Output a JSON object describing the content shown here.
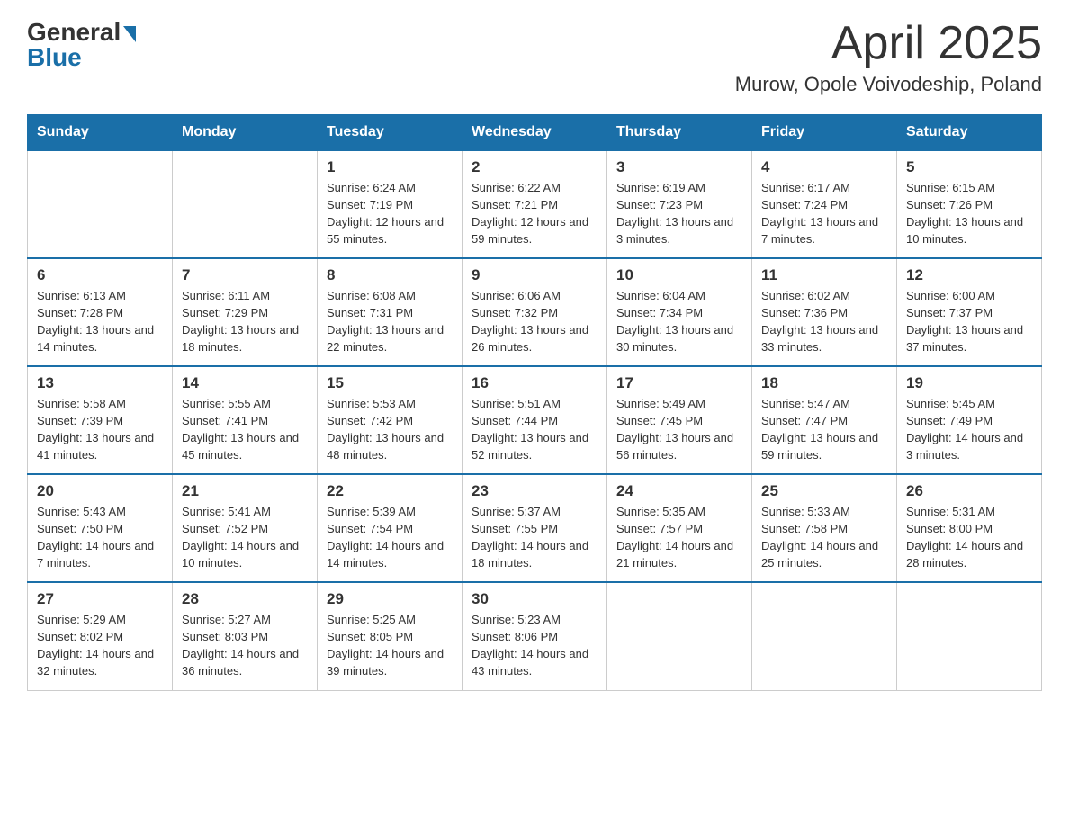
{
  "logo": {
    "general": "General",
    "blue": "Blue"
  },
  "header": {
    "month_year": "April 2025",
    "location": "Murow, Opole Voivodeship, Poland"
  },
  "weekdays": [
    "Sunday",
    "Monday",
    "Tuesday",
    "Wednesday",
    "Thursday",
    "Friday",
    "Saturday"
  ],
  "weeks": [
    [
      {
        "day": "",
        "sunrise": "",
        "sunset": "",
        "daylight": ""
      },
      {
        "day": "",
        "sunrise": "",
        "sunset": "",
        "daylight": ""
      },
      {
        "day": "1",
        "sunrise": "Sunrise: 6:24 AM",
        "sunset": "Sunset: 7:19 PM",
        "daylight": "Daylight: 12 hours and 55 minutes."
      },
      {
        "day": "2",
        "sunrise": "Sunrise: 6:22 AM",
        "sunset": "Sunset: 7:21 PM",
        "daylight": "Daylight: 12 hours and 59 minutes."
      },
      {
        "day": "3",
        "sunrise": "Sunrise: 6:19 AM",
        "sunset": "Sunset: 7:23 PM",
        "daylight": "Daylight: 13 hours and 3 minutes."
      },
      {
        "day": "4",
        "sunrise": "Sunrise: 6:17 AM",
        "sunset": "Sunset: 7:24 PM",
        "daylight": "Daylight: 13 hours and 7 minutes."
      },
      {
        "day": "5",
        "sunrise": "Sunrise: 6:15 AM",
        "sunset": "Sunset: 7:26 PM",
        "daylight": "Daylight: 13 hours and 10 minutes."
      }
    ],
    [
      {
        "day": "6",
        "sunrise": "Sunrise: 6:13 AM",
        "sunset": "Sunset: 7:28 PM",
        "daylight": "Daylight: 13 hours and 14 minutes."
      },
      {
        "day": "7",
        "sunrise": "Sunrise: 6:11 AM",
        "sunset": "Sunset: 7:29 PM",
        "daylight": "Daylight: 13 hours and 18 minutes."
      },
      {
        "day": "8",
        "sunrise": "Sunrise: 6:08 AM",
        "sunset": "Sunset: 7:31 PM",
        "daylight": "Daylight: 13 hours and 22 minutes."
      },
      {
        "day": "9",
        "sunrise": "Sunrise: 6:06 AM",
        "sunset": "Sunset: 7:32 PM",
        "daylight": "Daylight: 13 hours and 26 minutes."
      },
      {
        "day": "10",
        "sunrise": "Sunrise: 6:04 AM",
        "sunset": "Sunset: 7:34 PM",
        "daylight": "Daylight: 13 hours and 30 minutes."
      },
      {
        "day": "11",
        "sunrise": "Sunrise: 6:02 AM",
        "sunset": "Sunset: 7:36 PM",
        "daylight": "Daylight: 13 hours and 33 minutes."
      },
      {
        "day": "12",
        "sunrise": "Sunrise: 6:00 AM",
        "sunset": "Sunset: 7:37 PM",
        "daylight": "Daylight: 13 hours and 37 minutes."
      }
    ],
    [
      {
        "day": "13",
        "sunrise": "Sunrise: 5:58 AM",
        "sunset": "Sunset: 7:39 PM",
        "daylight": "Daylight: 13 hours and 41 minutes."
      },
      {
        "day": "14",
        "sunrise": "Sunrise: 5:55 AM",
        "sunset": "Sunset: 7:41 PM",
        "daylight": "Daylight: 13 hours and 45 minutes."
      },
      {
        "day": "15",
        "sunrise": "Sunrise: 5:53 AM",
        "sunset": "Sunset: 7:42 PM",
        "daylight": "Daylight: 13 hours and 48 minutes."
      },
      {
        "day": "16",
        "sunrise": "Sunrise: 5:51 AM",
        "sunset": "Sunset: 7:44 PM",
        "daylight": "Daylight: 13 hours and 52 minutes."
      },
      {
        "day": "17",
        "sunrise": "Sunrise: 5:49 AM",
        "sunset": "Sunset: 7:45 PM",
        "daylight": "Daylight: 13 hours and 56 minutes."
      },
      {
        "day": "18",
        "sunrise": "Sunrise: 5:47 AM",
        "sunset": "Sunset: 7:47 PM",
        "daylight": "Daylight: 13 hours and 59 minutes."
      },
      {
        "day": "19",
        "sunrise": "Sunrise: 5:45 AM",
        "sunset": "Sunset: 7:49 PM",
        "daylight": "Daylight: 14 hours and 3 minutes."
      }
    ],
    [
      {
        "day": "20",
        "sunrise": "Sunrise: 5:43 AM",
        "sunset": "Sunset: 7:50 PM",
        "daylight": "Daylight: 14 hours and 7 minutes."
      },
      {
        "day": "21",
        "sunrise": "Sunrise: 5:41 AM",
        "sunset": "Sunset: 7:52 PM",
        "daylight": "Daylight: 14 hours and 10 minutes."
      },
      {
        "day": "22",
        "sunrise": "Sunrise: 5:39 AM",
        "sunset": "Sunset: 7:54 PM",
        "daylight": "Daylight: 14 hours and 14 minutes."
      },
      {
        "day": "23",
        "sunrise": "Sunrise: 5:37 AM",
        "sunset": "Sunset: 7:55 PM",
        "daylight": "Daylight: 14 hours and 18 minutes."
      },
      {
        "day": "24",
        "sunrise": "Sunrise: 5:35 AM",
        "sunset": "Sunset: 7:57 PM",
        "daylight": "Daylight: 14 hours and 21 minutes."
      },
      {
        "day": "25",
        "sunrise": "Sunrise: 5:33 AM",
        "sunset": "Sunset: 7:58 PM",
        "daylight": "Daylight: 14 hours and 25 minutes."
      },
      {
        "day": "26",
        "sunrise": "Sunrise: 5:31 AM",
        "sunset": "Sunset: 8:00 PM",
        "daylight": "Daylight: 14 hours and 28 minutes."
      }
    ],
    [
      {
        "day": "27",
        "sunrise": "Sunrise: 5:29 AM",
        "sunset": "Sunset: 8:02 PM",
        "daylight": "Daylight: 14 hours and 32 minutes."
      },
      {
        "day": "28",
        "sunrise": "Sunrise: 5:27 AM",
        "sunset": "Sunset: 8:03 PM",
        "daylight": "Daylight: 14 hours and 36 minutes."
      },
      {
        "day": "29",
        "sunrise": "Sunrise: 5:25 AM",
        "sunset": "Sunset: 8:05 PM",
        "daylight": "Daylight: 14 hours and 39 minutes."
      },
      {
        "day": "30",
        "sunrise": "Sunrise: 5:23 AM",
        "sunset": "Sunset: 8:06 PM",
        "daylight": "Daylight: 14 hours and 43 minutes."
      },
      {
        "day": "",
        "sunrise": "",
        "sunset": "",
        "daylight": ""
      },
      {
        "day": "",
        "sunrise": "",
        "sunset": "",
        "daylight": ""
      },
      {
        "day": "",
        "sunrise": "",
        "sunset": "",
        "daylight": ""
      }
    ]
  ]
}
